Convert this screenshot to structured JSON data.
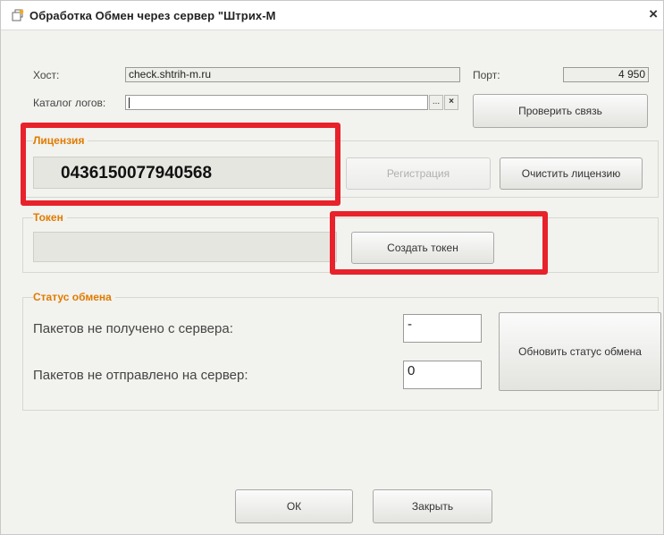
{
  "window": {
    "title": "Обработка  Обмен через сервер \"Штрих-М",
    "close_label": "×"
  },
  "connection": {
    "host_label": "Хост:",
    "host_value": "check.shtrih-m.ru",
    "port_label": "Порт:",
    "port_value": "4 950",
    "log_dir_label": "Каталог логов:",
    "log_dir_value": "",
    "browse_label": "...",
    "clear_label": "×",
    "check_button": "Проверить связь"
  },
  "license": {
    "title": "Лицензия",
    "number": "0436150077940568",
    "register_button": "Регистрация",
    "clear_button": "Очистить лицензию"
  },
  "token": {
    "title": "Токен",
    "value": "",
    "create_button": "Создать токен"
  },
  "exchange_status": {
    "title": "Статус обмена",
    "not_received_label": "Пакетов не получено с сервера:",
    "not_received_value": "-",
    "not_sent_label": "Пакетов не отправлено на сервер:",
    "not_sent_value": "0",
    "refresh_button": "Обновить статус обмена"
  },
  "footer": {
    "ok_button": "ОК",
    "close_button": "Закрыть"
  },
  "colors": {
    "highlight": "#e8222b",
    "group_title": "#e07b00",
    "window_bg": "#f2f2ee"
  }
}
